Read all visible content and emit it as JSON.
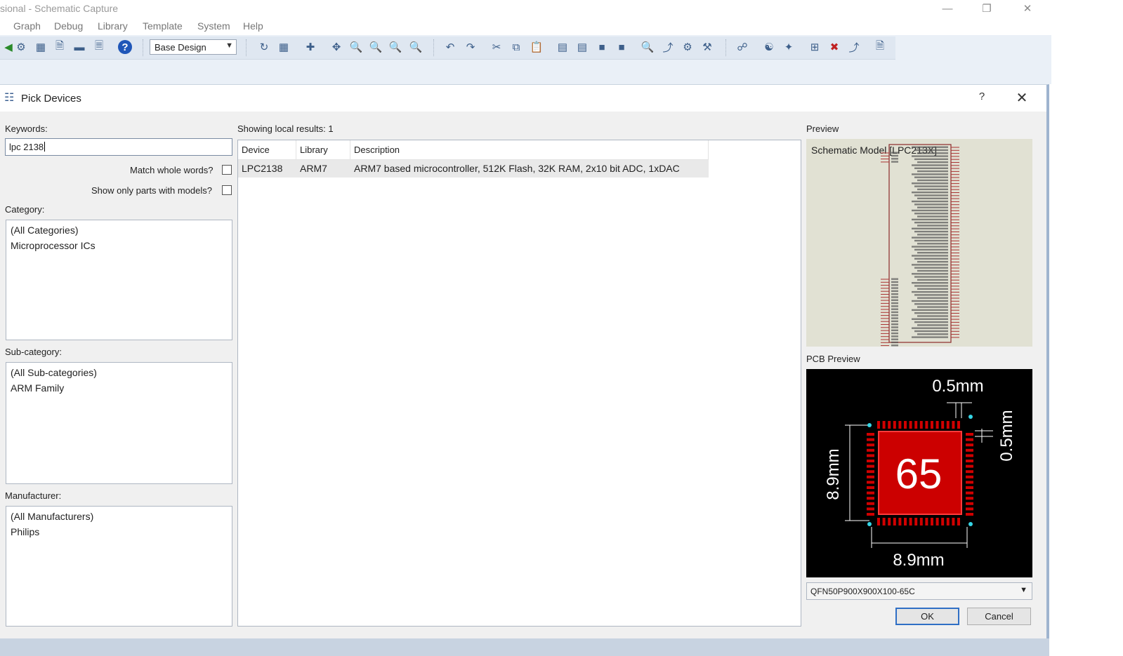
{
  "window": {
    "title": "sional - Schematic Capture"
  },
  "menu": [
    "Graph",
    "Debug",
    "Library",
    "Template",
    "System",
    "Help"
  ],
  "toolbar": {
    "design_select_value": "Base Design"
  },
  "dialog": {
    "title": "Pick Devices",
    "help_label": "?",
    "keywords_label": "Keywords:",
    "keywords_value": "lpc 2138",
    "match_whole_words_label": "Match whole words?",
    "show_only_models_label": "Show only parts with models?",
    "category_label": "Category:",
    "categories": [
      "(All Categories)",
      "Microprocessor ICs"
    ],
    "subcategory_label": "Sub-category:",
    "subcategories": [
      "(All Sub-categories)",
      "ARM Family"
    ],
    "manufacturer_label": "Manufacturer:",
    "manufacturers": [
      "(All Manufacturers)",
      "Philips"
    ],
    "results_label": "Showing local results: 1",
    "columns": [
      "Device",
      "Library",
      "Description"
    ],
    "rows": [
      {
        "device": "LPC2138",
        "library": "ARM7",
        "description": "ARM7 based microcontroller, 512K Flash, 32K RAM, 2x10 bit ADC, 1xDAC"
      }
    ],
    "preview_label": "Preview",
    "schematic_model_label": "Schematic Model [LPC213X]",
    "pcb_preview_label": "PCB Preview",
    "pcb": {
      "pad_count": "65",
      "pitch_top": "0.5mm",
      "pitch_right": "0.5mm",
      "height_label": "8.9mm",
      "width_label": "8.9mm"
    },
    "footprint_value": "QFN50P900X900X100-65C",
    "ok_label": "OK",
    "cancel_label": "Cancel"
  }
}
